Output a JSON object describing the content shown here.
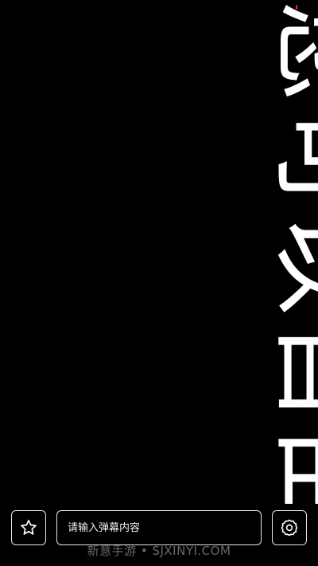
{
  "danmaku": {
    "text": "您可以自由"
  },
  "controls": {
    "star_icon": "star-icon",
    "settings_icon": "gear-icon",
    "input_placeholder": "请输入弹幕内容",
    "input_value": ""
  },
  "watermark": {
    "text": "新意手游 • SJXINYI.COM"
  },
  "colors": {
    "background": "#000000",
    "foreground": "#ffffff",
    "border": "#e6e6e6"
  }
}
